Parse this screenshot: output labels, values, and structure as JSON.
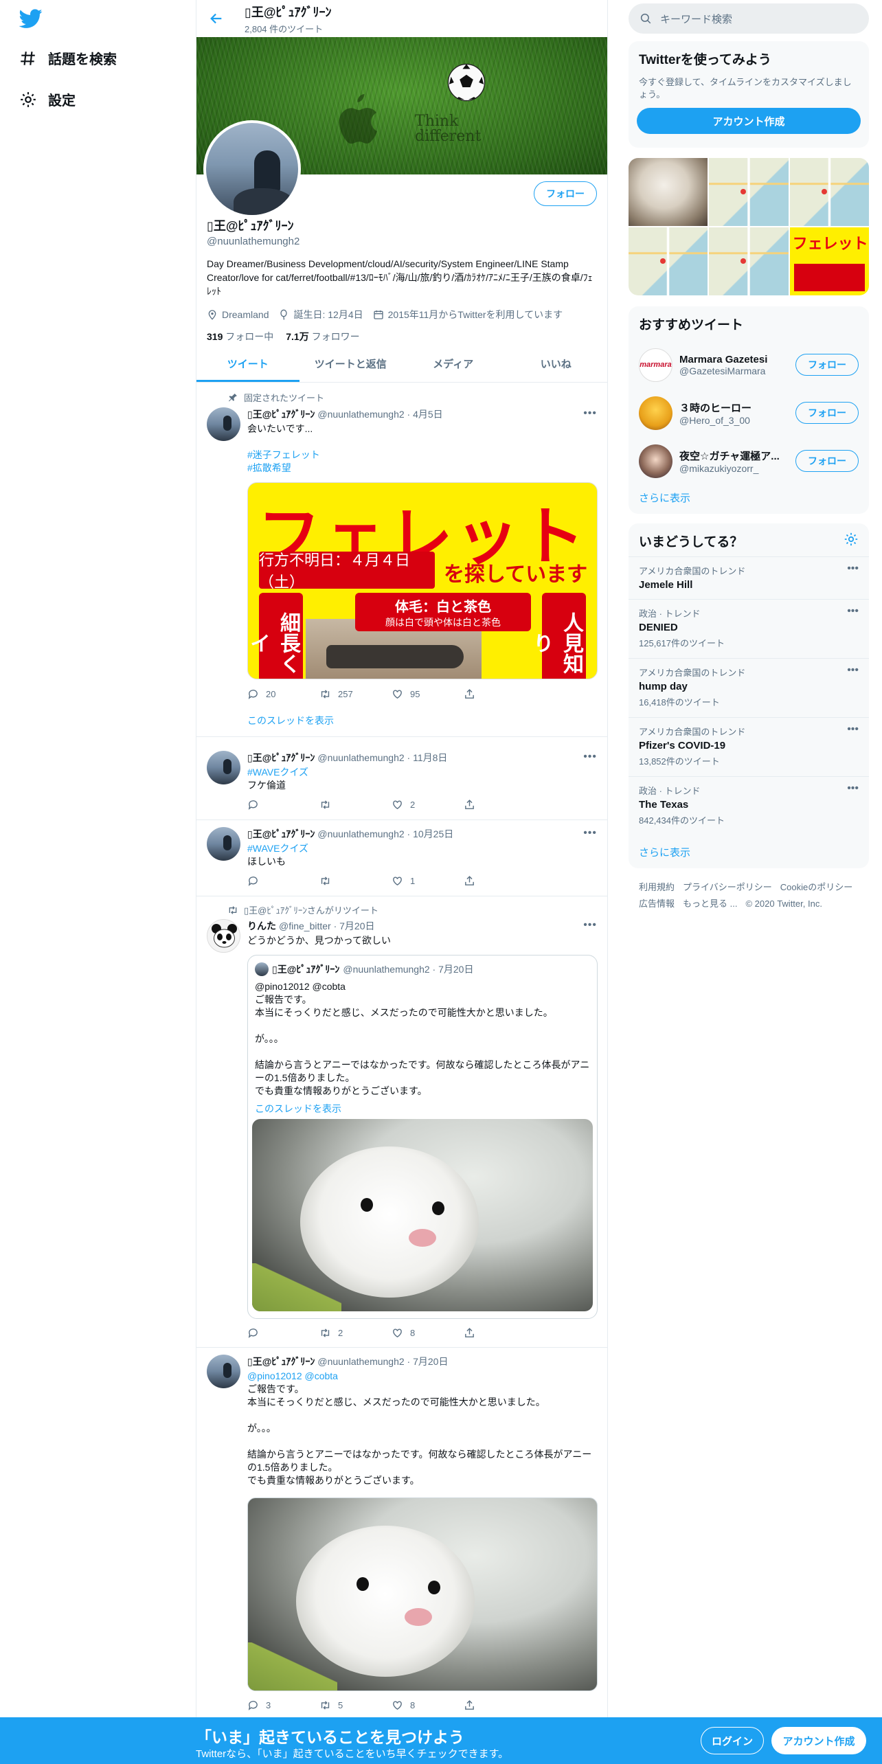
{
  "nav": {
    "explore_label": "話題を検索",
    "settings_label": "設定"
  },
  "header": {
    "title": "▯王@ﾋﾟｭｱｸﾞﾘｰﾝ",
    "tweet_count": "2,804 件のツイート"
  },
  "banner": {
    "text_line1": "Think",
    "text_line2": "different"
  },
  "profile": {
    "name": "▯王@ﾋﾟｭｱｸﾞﾘｰﾝ",
    "handle": "@nuunlathemungh2",
    "follow_label": "フォロー",
    "bio": "Day Dreamer/Business Development/cloud/AI/security/System Engineer/LINE Stamp Creator/love for cat/ferret/football/#13/ﾛｰﾓﾊﾞ/海/山/旅/釣り/酒/ｶﾗｵｹ/ｱﾆﾒ/ﾆ王子/王族の食卓/ﾌｪﾚｯﾄ",
    "location": "Dreamland",
    "birthday": "誕生日: 12月4日",
    "joined": "2015年11月からTwitterを利用しています",
    "following_count": "319",
    "following_label": "フォロー中",
    "followers_count": "7.1万",
    "followers_label": "フォロワー"
  },
  "tabs": [
    "ツイート",
    "ツイートと返信",
    "メディア",
    "いいね"
  ],
  "tweets": [
    {
      "context": "固定されたツイート",
      "name": "▯王@ﾋﾟｭｱｸﾞﾘｰﾝ",
      "meta": "@nuunlathemungh2 · 4月5日",
      "text": "会いたいです...",
      "hashtags": "#迷子フェレット\n#拡散希望",
      "poster": {
        "headline": "フェレット",
        "lost_date": "行方不明日：４月４日（土）",
        "searching": "を探しています",
        "color_title": "体毛：白と茶色",
        "color_sub": "顔は白で頭や体は白と茶色",
        "left_strip": "細長くイ",
        "right_strip": "人見知り"
      },
      "replies": "20",
      "retweets": "257",
      "likes": "95",
      "thread_link": "このスレッドを表示"
    },
    {
      "name": "▯王@ﾋﾟｭｱｸﾞﾘｰﾝ",
      "meta": "@nuunlathemungh2 · 11月8日",
      "hashtag": "#WAVEクイズ",
      "text": "フケ倫道",
      "replies": "",
      "retweets": "",
      "likes": "2"
    },
    {
      "name": "▯王@ﾋﾟｭｱｸﾞﾘｰﾝ",
      "meta": "@nuunlathemungh2 · 10月25日",
      "hashtag": "#WAVEクイズ",
      "text": "ほしいも",
      "replies": "",
      "retweets": "",
      "likes": "1"
    },
    {
      "context": "▯王@ﾋﾟｭｱｸﾞﾘｰﾝさんがリツイート",
      "name": "りんた",
      "meta": "@fine_bitter · 7月20日",
      "text": "どうかどうか、見つかって欲しい",
      "quote": {
        "name": "▯王@ﾋﾟｭｱｸﾞﾘｰﾝ",
        "meta": "@nuunlathemungh2 · 7月20日",
        "text": "@pino12012 @cobta\nご報告です。\n本当にそっくりだと感じ、メスだったので可能性大かと思いました。\n\nが。。。\n\n結論から言うとアニーではなかったです。何故なら確認したところ体長がアニーの1.5倍ありました。\nでも貴重な情報ありがとうございます。",
        "thread_link": "このスレッドを表示"
      },
      "replies": "",
      "retweets": "2",
      "likes": "8"
    },
    {
      "name": "▯王@ﾋﾟｭｱｸﾞﾘｰﾝ",
      "meta": "@nuunlathemungh2 · 7月20日",
      "mentions": "@pino12012 @cobta",
      "text": "ご報告です。\n本当にそっくりだと感じ、メスだったので可能性大かと思いました。\n\nが。。。\n\n結論から言うとアニーではなかったです。何故なら確認したところ体長がアニーの1.5倍ありました。\nでも貴重な情報ありがとうございます。",
      "replies": "3",
      "retweets": "5",
      "likes": "8"
    }
  ],
  "sidebar": {
    "search_placeholder": "キーワード検索",
    "signup_title": "Twitterを使ってみよう",
    "signup_desc": "今すぐ登録して、タイムラインをカスタマイズしましょう。",
    "signup_button": "アカウント作成",
    "media_poster_text": "フェレット",
    "recommend_title": "おすすめツイート",
    "recommend": [
      {
        "name": "Marmara Gazetesi",
        "handle": "@GazetesiMarmara",
        "follow": "フォロー",
        "avatar_text": "marmara"
      },
      {
        "name": "３時のヒーロー",
        "handle": "@Hero_of_3_00",
        "follow": "フォロー"
      },
      {
        "name": "夜空☆ガチャ運極ア...",
        "handle": "@mikazukiyozorr_",
        "follow": "フォロー"
      }
    ],
    "show_more": "さらに表示",
    "trends_title": "いまどうしてる？",
    "trends": [
      {
        "context": "アメリカ合衆国のトレンド",
        "name": "Jemele Hill",
        "count": ""
      },
      {
        "context": "政治 · トレンド",
        "name": "DENIED",
        "count": "125,617件のツイート"
      },
      {
        "context": "アメリカ合衆国のトレンド",
        "name": "hump day",
        "count": "16,418件のツイート"
      },
      {
        "context": "アメリカ合衆国のトレンド",
        "name": "Pfizer's COVID-19",
        "count": "13,852件のツイート"
      },
      {
        "context": "政治 · トレンド",
        "name": "The Texas",
        "count": "842,434件のツイート"
      }
    ],
    "trends_more": "さらに表示",
    "footer": [
      "利用規約",
      "プライバシーポリシー",
      "Cookieのポリシー",
      "広告情報",
      "もっと見る ...",
      "© 2020 Twitter, Inc."
    ]
  },
  "bottom_bar": {
    "title": "「いま」起きていることを見つけよう",
    "subtitle": "Twitterなら、「いま」起きていることをいち早くチェックできます。",
    "login": "ログイン",
    "signup": "アカウント作成"
  },
  "colors": {
    "accent": "#1da1f2",
    "text": "#0f1419",
    "muted": "#5b7083",
    "poster_yellow": "#ffef00",
    "poster_red": "#e60012"
  }
}
